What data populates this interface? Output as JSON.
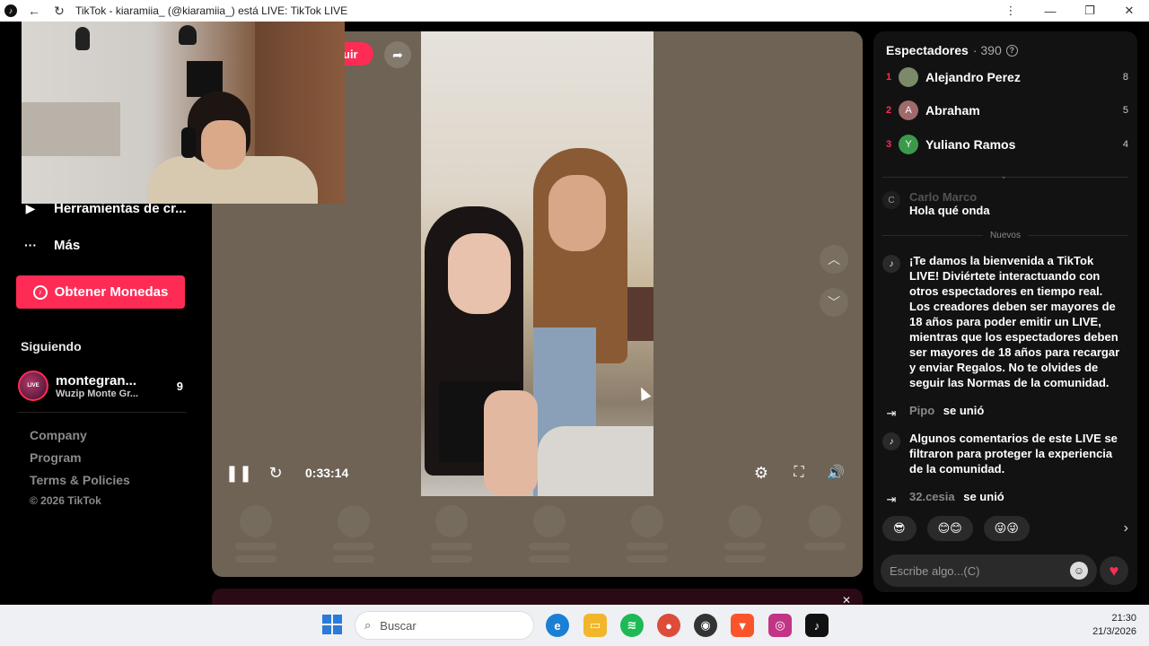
{
  "window": {
    "title": "TikTok - kiaramiia_ (@kiaramiia_) está LIVE: TikTok LIVE"
  },
  "sidebar": {
    "menu": [
      {
        "label": "Herramientas de cr...",
        "icon": "play-box-icon"
      },
      {
        "label": "Más",
        "icon": "more-icon"
      }
    ],
    "coins_button": "Obtener Monedas",
    "following_title": "Siguiendo",
    "following": [
      {
        "name": "montegran...",
        "subtitle": "Wuzip Monte Gr...",
        "count": "9",
        "badge": "LIVE"
      }
    ],
    "footer_links": [
      "Company",
      "Program",
      "Terms & Policies"
    ],
    "copyright": "© 2026 TikTok"
  },
  "player": {
    "follow_label": "uir",
    "time": "0:33:14"
  },
  "viewers": {
    "title": "Espectadores",
    "count": "· 390",
    "list": [
      {
        "rank": "1",
        "initial": "",
        "name": "Alejandro Perez",
        "score": "8",
        "color": "#7a8a6a"
      },
      {
        "rank": "2",
        "initial": "A",
        "name": "Abraham",
        "score": "5",
        "color": "#a06a6a"
      },
      {
        "rank": "3",
        "initial": "Y",
        "name": "Yuliano Ramos",
        "score": "4",
        "color": "#3a9a4a"
      }
    ]
  },
  "chat": {
    "faded": {
      "user": "Carlo Marco",
      "text": "Hola qué onda"
    },
    "divider": "Nuevos",
    "welcome": "¡Te damos la bienvenida a TikTok LIVE! Diviértete interactuando con otros espectadores en tiempo real. Los creadores deben ser mayores de 18 años para poder emitir un LIVE, mientras que los espectadores deben ser mayores de 18 años para recargar y enviar Regalos. No te olvides de seguir las Normas de la comunidad.",
    "join1": {
      "user": "Pipo",
      "text": "se unió"
    },
    "filtered": "Algunos comentarios de este LIVE se filtraron para proteger la experiencia de la comunidad.",
    "join2": {
      "user": "32.cesia",
      "text": "se unió"
    },
    "quick_emojis": [
      "😎",
      "😊😊",
      "😜😜"
    ],
    "input_placeholder": "Escribe algo...(C)"
  },
  "taskbar": {
    "search_placeholder": "Buscar",
    "time": "21:30",
    "date": "21/3/2026"
  },
  "colors": {
    "accent": "#fe2c55",
    "player_bg": "#6e6354",
    "panel_bg": "#121212"
  }
}
